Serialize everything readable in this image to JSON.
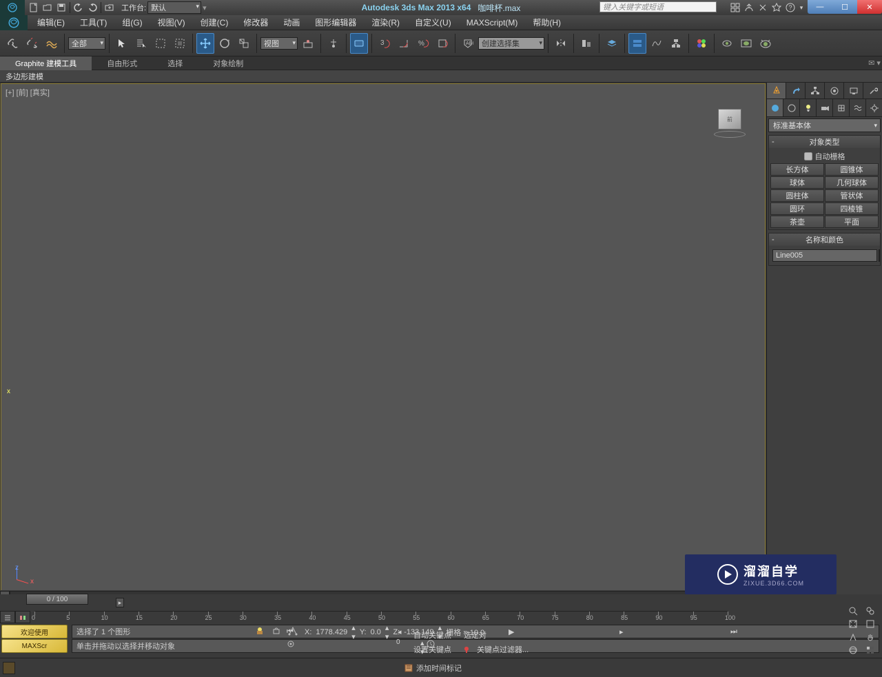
{
  "title": {
    "app": "Autodesk 3ds Max  2013 x64",
    "doc": "咖啡杯.max"
  },
  "workspace": {
    "label": "工作台:",
    "value": "默认"
  },
  "search": {
    "placeholder": "键入关键字或短语"
  },
  "menu": [
    "编辑(E)",
    "工具(T)",
    "组(G)",
    "视图(V)",
    "创建(C)",
    "修改器",
    "动画",
    "图形编辑器",
    "渲染(R)",
    "自定义(U)",
    "MAXScript(M)",
    "帮助(H)"
  ],
  "toolbar": {
    "filter": "全部",
    "refcoord": "视图",
    "named_sel": "创建选择集"
  },
  "ribbon": {
    "tabs": [
      "Graphite 建模工具",
      "自由形式",
      "选择",
      "对象绘制"
    ],
    "active": 0,
    "sub": "多边形建模"
  },
  "viewport": {
    "label": "[+] [前] [真实]",
    "cube": "前"
  },
  "cmd": {
    "category": "标准基本体",
    "rollout_objtype": "对象类型",
    "autogrid": "自动栅格",
    "primitives": [
      [
        "长方体",
        "圆锥体"
      ],
      [
        "球体",
        "几何球体"
      ],
      [
        "圆柱体",
        "管状体"
      ],
      [
        "圆环",
        "四棱锥"
      ],
      [
        "茶壶",
        "平面"
      ]
    ],
    "rollout_name": "名称和颜色",
    "selname": "Line005"
  },
  "timeline": {
    "handle": "0 / 100",
    "ticks": [
      0,
      5,
      10,
      15,
      20,
      25,
      30,
      35,
      40,
      45,
      50,
      55,
      60,
      65,
      70,
      75,
      80,
      85,
      90,
      95,
      100
    ]
  },
  "status": {
    "tag1": "欢迎使用",
    "tag2": "MAXScr",
    "line1": "选择了 1 个图形",
    "line2": "单击并拖动以选择并移动对象",
    "x": "1778.429",
    "y": "0.0",
    "z": "-133.149",
    "grid": "栅格 = 10.0",
    "addtag": "添加时间标记",
    "auto_key": "自动关键点",
    "set_key": "设置关键点",
    "sel_label": "选定对",
    "keyfilter": "关键点过滤器..."
  },
  "watermark": {
    "big": "溜溜自学",
    "small": "ZIXUE.3D66.COM"
  }
}
